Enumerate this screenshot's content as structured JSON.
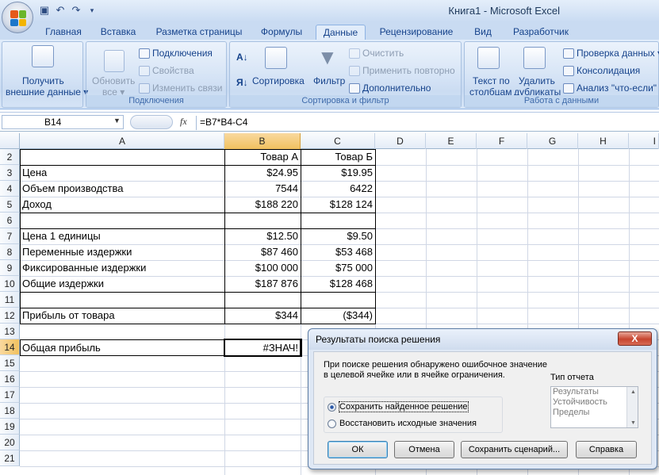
{
  "window": {
    "title": "Книга1 - Microsoft Excel"
  },
  "qat": {
    "save_icon": "save-icon",
    "undo_icon": "undo-icon",
    "redo_icon": "redo-icon"
  },
  "tabs": [
    "Главная",
    "Вставка",
    "Разметка страницы",
    "Формулы",
    "Данные",
    "Рецензирование",
    "Вид",
    "Разработчик"
  ],
  "active_tab": "Данные",
  "ribbon": {
    "external": {
      "label_1": "Получить",
      "label_2": "внешние данные ▾"
    },
    "connections": {
      "refresh_1": "Обновить",
      "refresh_2": "все ▾",
      "connections": "Подключения",
      "properties": "Свойства",
      "edit_links": "Изменить связи",
      "group": "Подключения"
    },
    "sort": {
      "sort": "Сортировка",
      "filter": "Фильтр",
      "clear": "Очистить",
      "reapply": "Применить повторно",
      "advanced": "Дополнительно",
      "group": "Сортировка и фильтр"
    },
    "data_tools": {
      "text_1": "Текст по",
      "text_2": "столбцам",
      "dup_1": "Удалить",
      "dup_2": "дубликаты",
      "validation": "Проверка данных ▾",
      "consolidate": "Консолидация",
      "whatif": "Анализ \"что-если\" ▾",
      "group": "Работа с данными"
    }
  },
  "formula_bar": {
    "name_box": "B14",
    "fx": "fx",
    "formula": "=B7*B4-C4"
  },
  "columns": [
    "A",
    "B",
    "C",
    "D",
    "E",
    "F",
    "G",
    "H",
    "I"
  ],
  "rows": [
    "2",
    "3",
    "4",
    "5",
    "6",
    "7",
    "8",
    "9",
    "10",
    "11",
    "12",
    "13",
    "14",
    "15",
    "16",
    "17",
    "18",
    "19",
    "20",
    "21"
  ],
  "cells": {
    "b2": "Товар А",
    "c2": "Товар Б",
    "a3": "Цена",
    "b3": "$24.95",
    "c3": "$19.95",
    "a4": "Объем производства",
    "b4": "7544",
    "c4": "6422",
    "a5": "Доход",
    "b5": "$188 220",
    "c5": "$128 124",
    "a7": "Цена 1 единицы",
    "b7": "$12.50",
    "c7": "$9.50",
    "a8": "Переменные издержки",
    "b8": "$87 460",
    "c8": "$53 468",
    "a9": "Фиксированные издержки",
    "b9": "$100 000",
    "c9": "$75 000",
    "a10": "Общие издержки",
    "b10": "$187 876",
    "c10": "$128 468",
    "a12": "Прибыль от товара",
    "b12": "$344",
    "c12": "($344)",
    "a14": "Общая прибыль",
    "b14": "#ЗНАЧ!"
  },
  "dialog": {
    "title": "Результаты поиска решения",
    "close": "X",
    "message_1": "При поиске решения обнаружено ошибочное значение",
    "message_2": "в целевой ячейке или в ячейке ограничения.",
    "report_type": "Тип отчета",
    "reports": [
      "Результаты",
      "Устойчивость",
      "Пределы"
    ],
    "radio_keep": "Сохранить найденное решение",
    "radio_restore": "Восстановить исходные значения",
    "btn_ok": "ОК",
    "btn_cancel": "Отмена",
    "btn_save_scenario": "Сохранить сценарий...",
    "btn_help": "Справка"
  }
}
